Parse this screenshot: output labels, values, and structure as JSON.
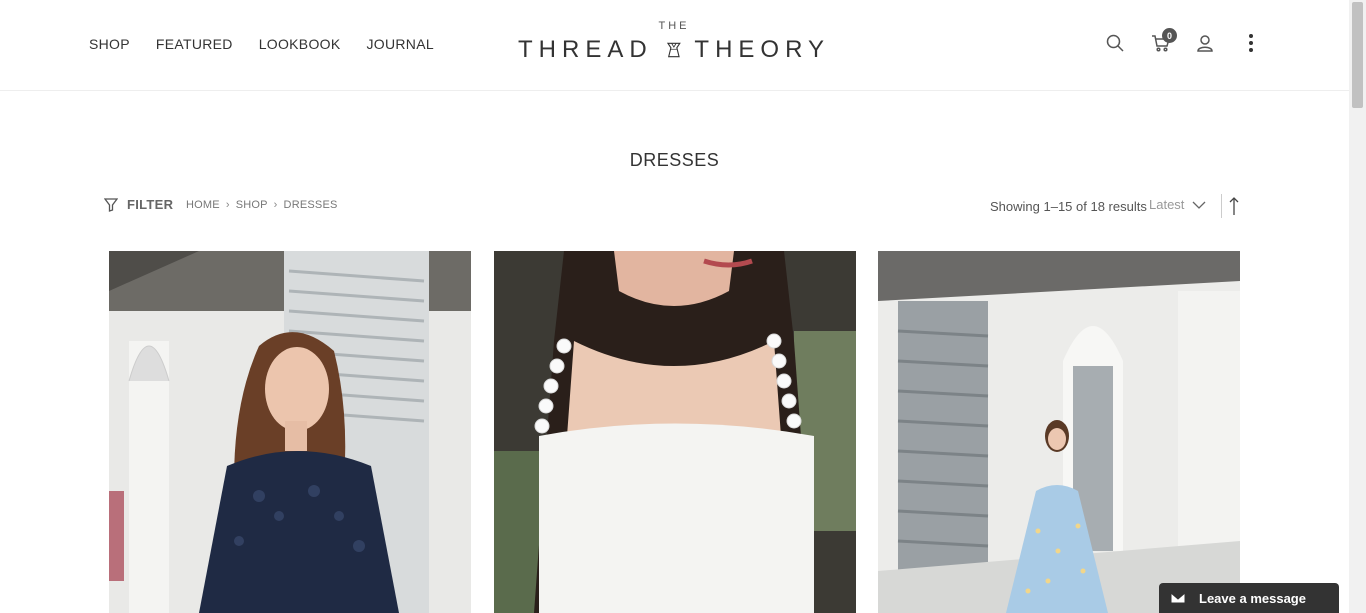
{
  "nav": {
    "items": [
      {
        "label": "SHOP"
      },
      {
        "label": "FEATURED"
      },
      {
        "label": "LOOKBOOK"
      },
      {
        "label": "JOURNAL"
      }
    ]
  },
  "logo": {
    "top_text": "THE",
    "left_word": "THREAD",
    "right_word": "THEORY"
  },
  "header_icons": {
    "search": "search-icon",
    "cart": "cart-icon",
    "cart_count": "0",
    "account": "user-icon",
    "more": "vertical-dots-icon"
  },
  "page": {
    "title": "DRESSES"
  },
  "toolbar": {
    "filter_label": "FILTER",
    "breadcrumb": [
      "HOME",
      "SHOP",
      "DRESSES"
    ],
    "results_text": "Showing 1–15 of 18 results",
    "sort_selected": "Latest"
  },
  "chat": {
    "label": "Leave a message"
  },
  "colors": {
    "text": "#333333",
    "muted": "#777777",
    "chat_bg": "#333333",
    "navy_dress": "#1f2a44",
    "light_blue_dress": "#a9cbe6"
  }
}
